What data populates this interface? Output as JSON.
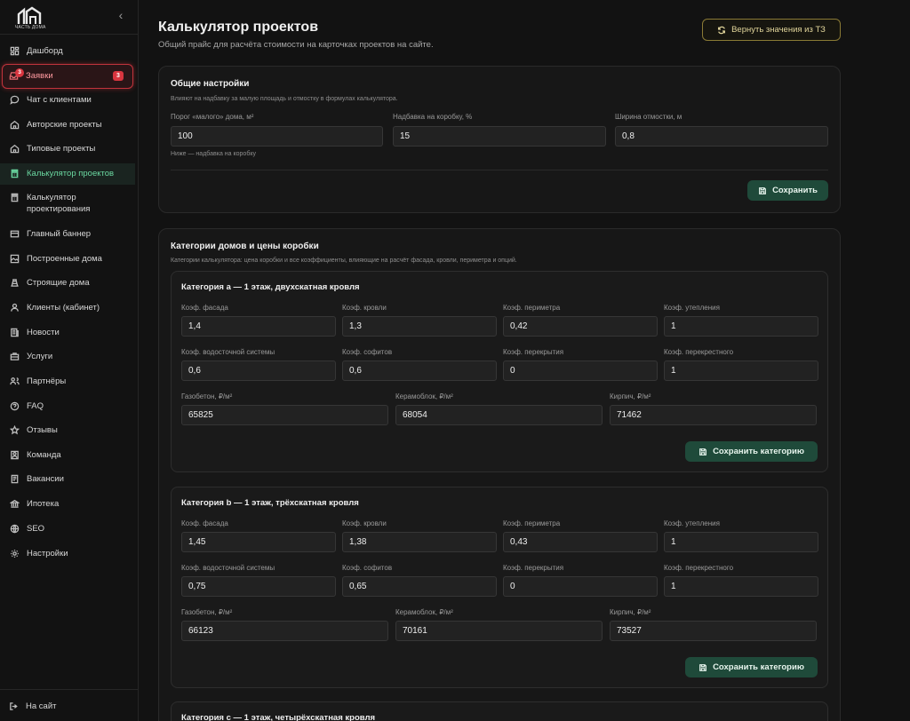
{
  "sidebar": {
    "logo_text": "ЧАСТЬ ДОМА",
    "collapse_glyph": "‹",
    "items": [
      {
        "label": "Дашборд",
        "icon": "dashboard-icon"
      },
      {
        "label": "Заявки",
        "icon": "inbox-icon",
        "badge": "3",
        "count": "3"
      },
      {
        "label": "Чат с клиентами",
        "icon": "chat-icon"
      },
      {
        "label": "Авторские проекты",
        "icon": "home-icon"
      },
      {
        "label": "Типовые проекты",
        "icon": "home-icon"
      },
      {
        "label": "Калькулятор проектов",
        "icon": "calculator-icon"
      },
      {
        "label": "Калькулятор проектирования",
        "icon": "calculator-icon"
      },
      {
        "label": "Главный баннер",
        "icon": "banner-icon"
      },
      {
        "label": "Построенные дома",
        "icon": "image-icon"
      },
      {
        "label": "Строящие дома",
        "icon": "construction-icon"
      },
      {
        "label": "Клиенты (кабинет)",
        "icon": "user-icon"
      },
      {
        "label": "Новости",
        "icon": "news-icon"
      },
      {
        "label": "Услуги",
        "icon": "briefcase-icon"
      },
      {
        "label": "Партнёры",
        "icon": "partners-icon"
      },
      {
        "label": "FAQ",
        "icon": "question-icon"
      },
      {
        "label": "Отзывы",
        "icon": "star-icon"
      },
      {
        "label": "Команда",
        "icon": "team-icon"
      },
      {
        "label": "Вакансии",
        "icon": "vacancy-icon"
      },
      {
        "label": "Ипотека",
        "icon": "bank-icon"
      },
      {
        "label": "SEO",
        "icon": "globe-icon"
      },
      {
        "label": "Настройки",
        "icon": "gear-icon"
      }
    ],
    "to_site_label": "На сайт"
  },
  "header": {
    "title": "Калькулятор проектов",
    "subtitle": "Общий прайс для расчёта стоимости на карточках проектов на сайте.",
    "reset_label": "Вернуть значения из ТЗ"
  },
  "general": {
    "title": "Общие настройки",
    "desc": "Влияют на надбавку за малую площадь и отмостку в формулах калькулятора.",
    "fields": [
      {
        "label": "Порог «малого» дома, м²",
        "value": "100"
      },
      {
        "label": "Надбавка на коробку, %",
        "value": "15"
      },
      {
        "label": "Ширина отмостки, м",
        "value": "0,8"
      }
    ],
    "hint": "Ниже — надбавка на коробку",
    "save_label": "Сохранить"
  },
  "categories": {
    "title": "Категории домов и цены коробки",
    "desc": "Категории калькулятора: цена коробки и все коэффициенты, влияющие на расчёт фасада, кровли, периметра и опций.",
    "save_label": "Сохранить категорию",
    "items": [
      {
        "title": "Категория a — 1 этаж, двухскатная кровля",
        "row1": [
          {
            "label": "Коэф. фасада",
            "value": "1,4"
          },
          {
            "label": "Коэф. кровли",
            "value": "1,3"
          },
          {
            "label": "Коэф. периметра",
            "value": "0,42"
          },
          {
            "label": "Коэф. утепления",
            "value": "1"
          }
        ],
        "row2": [
          {
            "label": "Коэф. водосточной системы",
            "value": "0,6"
          },
          {
            "label": "Коэф. софитов",
            "value": "0,6"
          },
          {
            "label": "Коэф. перекрытия",
            "value": "0"
          },
          {
            "label": "Коэф. перекрестного",
            "value": "1"
          }
        ],
        "row3": [
          {
            "label": "Газобетон, ₽/м²",
            "value": "65825"
          },
          {
            "label": "Керамоблок, ₽/м²",
            "value": "68054"
          },
          {
            "label": "Кирпич, ₽/м²",
            "value": "71462"
          }
        ]
      },
      {
        "title": "Категория b — 1 этаж, трёхскатная кровля",
        "row1": [
          {
            "label": "Коэф. фасада",
            "value": "1,45"
          },
          {
            "label": "Коэф. кровли",
            "value": "1,38"
          },
          {
            "label": "Коэф. периметра",
            "value": "0,43"
          },
          {
            "label": "Коэф. утепления",
            "value": "1"
          }
        ],
        "row2": [
          {
            "label": "Коэф. водосточной системы",
            "value": "0,75"
          },
          {
            "label": "Коэф. софитов",
            "value": "0,65"
          },
          {
            "label": "Коэф. перекрытия",
            "value": "0"
          },
          {
            "label": "Коэф. перекрестного",
            "value": "1"
          }
        ],
        "row3": [
          {
            "label": "Газобетон, ₽/м²",
            "value": "66123"
          },
          {
            "label": "Керамоблок, ₽/м²",
            "value": "70161"
          },
          {
            "label": "Кирпич, ₽/м²",
            "value": "73527"
          }
        ]
      },
      {
        "title": "Категория c — 1 этаж, четырёхскатная кровля"
      }
    ]
  }
}
